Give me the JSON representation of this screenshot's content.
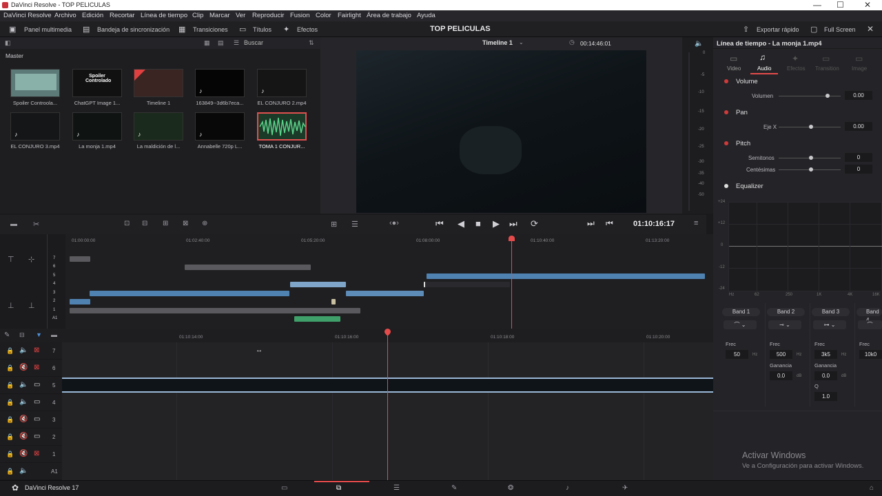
{
  "window": {
    "title": "DaVinci Resolve - TOP PELICULAS",
    "controls": [
      "—",
      "☐",
      "✕"
    ]
  },
  "menu": [
    "DaVinci Resolve",
    "Archivo",
    "Edición",
    "Recortar",
    "Línea de tiempo",
    "Clip",
    "Marcar",
    "Ver",
    "Reproducir",
    "Fusion",
    "Color",
    "Fairlight",
    "Área de trabajo",
    "Ayuda"
  ],
  "pagebar": {
    "media_pool": "Panel multimedia",
    "sync_bin": "Bandeja de sincronización",
    "transitions": "Transiciones",
    "titles": "Títulos",
    "effects": "Efectos",
    "project": "TOP PELICULAS",
    "quick_export": "Exportar rápido",
    "full_screen": "Full Screen"
  },
  "pool": {
    "search": "Buscar",
    "bin": "Master",
    "clips": [
      "Spoiler Controola...",
      "ChatGPT Image 1...",
      "Timeline 1",
      "163849--3d6b7eca...",
      "EL CONJURO 2.mp4",
      "EL CONJURO 3.mp4",
      "La monja 1.mp4",
      "La maldición de l...",
      "Annabelle 720p L...",
      "TOMA 1 CONJUR..."
    ],
    "thumb_text": [
      "Spoiler Controlado"
    ]
  },
  "viewer": {
    "timeline": "Timeline 1",
    "timecode_top": "00:14:46:01",
    "timecode": "01:10:16:17"
  },
  "meters": [
    "0",
    "-5",
    "-10",
    "-15",
    "-20",
    "-25",
    "-30",
    "-35",
    "-40",
    "-50"
  ],
  "inspector": {
    "title": "Línea de tiempo - La monja 1.mp4",
    "tabs": [
      "Video",
      "Audio",
      "Efectos",
      "Transition",
      "Image"
    ],
    "volume": {
      "label": "Volume",
      "param": "Volumen",
      "value": "0.00"
    },
    "pan": {
      "label": "Pan",
      "param": "Eje X",
      "value": "0.00"
    },
    "pitch": {
      "label": "Pitch",
      "semitones": "Semitonos",
      "semitones_value": "0",
      "cents": "Centésimas",
      "cents_value": "0"
    },
    "eq": {
      "label": "Equalizer",
      "y_ticks": [
        "+24",
        "+12",
        "0",
        "-12",
        "-24"
      ],
      "x_ticks": [
        "Hz",
        "62",
        "250",
        "1K",
        "4K",
        "16K"
      ],
      "bands": [
        "Band 1",
        "Band 2",
        "Band 3",
        "Band 4"
      ],
      "frec_label": "Frec",
      "gain_label": "Ganancia",
      "q_label": "Q",
      "b1": {
        "frec": "50",
        "unit": "Hz"
      },
      "b2": {
        "frec": "500",
        "unit": "Hz",
        "gain": "0.0",
        "gunit": "dB"
      },
      "b3": {
        "frec": "3k5",
        "unit": "Hz",
        "gain": "0.0",
        "gunit": "dB",
        "q": "1.0"
      },
      "b4": {
        "frec": "10k0",
        "unit": "Hz"
      }
    },
    "watermark1": "Activar Windows",
    "watermark2": "Ve a Configuración para activar Windows."
  },
  "mini_ruler": [
    "01:00:00:00",
    "01:02:40:00",
    "01:05:20:00",
    "01:08:00:00",
    "01:10:40:00",
    "01:13:20:00"
  ],
  "mini_tracks": [
    "7",
    "6",
    "5",
    "4",
    "3",
    "2",
    "1",
    "A1"
  ],
  "main_ruler": [
    "01:10:14:00",
    "01:10:16:00",
    "01:10:18:00",
    "01:10:20:00"
  ],
  "tracks": [
    "7",
    "6",
    "5",
    "4",
    "3",
    "2",
    "1",
    "A1"
  ],
  "app": "DaVinci Resolve 17",
  "colors": {
    "accent": "#e64b4b",
    "clip_blue": "#4f82b0",
    "clip_gray": "#5a5a5e",
    "clip_green": "#3fa06a"
  }
}
